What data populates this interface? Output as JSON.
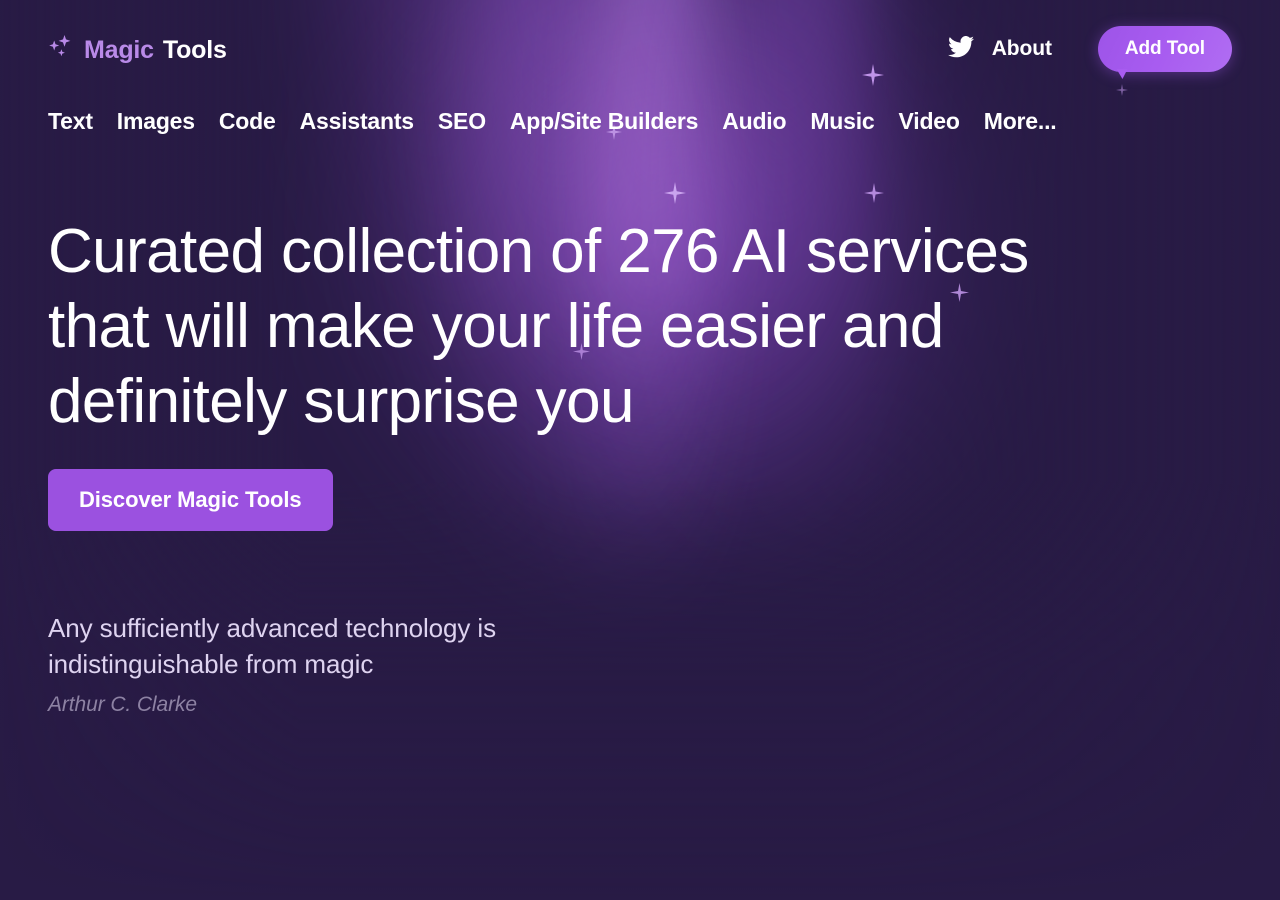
{
  "brand": {
    "icon": "sparkles-icon",
    "name_accent": "Magic",
    "name_plain": "Tools",
    "accent_color": "#b98ae8"
  },
  "topbar": {
    "twitter_icon": "twitter-icon",
    "about_label": "About",
    "add_tool_label": "Add Tool",
    "add_tool_color": "#a85cf0"
  },
  "nav": {
    "items": [
      {
        "label": "Text"
      },
      {
        "label": "Images"
      },
      {
        "label": "Code"
      },
      {
        "label": "Assistants"
      },
      {
        "label": "SEO"
      },
      {
        "label": "App/Site Builders"
      },
      {
        "label": "Audio"
      },
      {
        "label": "Music"
      },
      {
        "label": "Video"
      },
      {
        "label": "More..."
      }
    ]
  },
  "hero": {
    "title": "Curated collection of 276 AI services that will make your life easier and definitely surprise you",
    "service_count": "276",
    "cta_label": "Discover Magic Tools",
    "cta_color": "#9b51e0"
  },
  "quote": {
    "text": "Any sufficiently advanced technology is indistinguishable from magic",
    "author": "Arthur C. Clarke"
  },
  "theme": {
    "background": "#281b45",
    "glow": "#8042be",
    "text": "#ffffff",
    "quote_text": "#ded3f0",
    "quote_author": "#8d82a3"
  }
}
